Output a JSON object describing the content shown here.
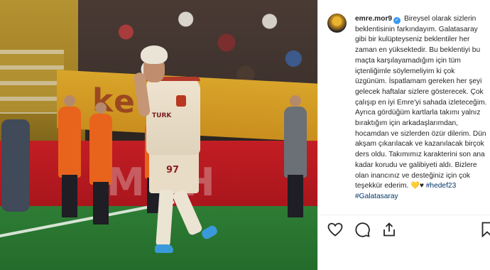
{
  "photo": {
    "banner_text": "keT",
    "wall_text": "MAH",
    "sponsor_text": "TURK",
    "jersey_number": "97"
  },
  "post": {
    "username": "emre.mor9",
    "caption_text": "Bireysel olarak sizlerin beklentisinin farkındayım. Galatasaray gibi bir kulüpteyseniz beklentiler her zaman en yüksektedir. Bu beklentiyi bu maçta karşılayamadığım için tüm içtenliğimle söylemeliyim ki çok üzgünüm. İspatlamam gereken her şeyi gelecek haftalar sizlere gösterecek. Çok çalışıp en iyi Emre'yi sahada izleteceğim. Ayrıca gördüğüm kartlarla takımı yalnız bıraktığım için arkadaşlarımdan, hocamdan ve sizlerden özür dilerim. Dün akşam çıkarılacak ve kazanılacak birçok ders oldu. Takımımız karakterini son ana kadar korudu ve galibiyeti aldı. Bizlere olan inancınız ve desteğiniz için çok teşekkür ederim.",
    "heart_yellow": "💛",
    "heart_black": "♥",
    "hashtag_1": "#hedef23",
    "hashtag_2": "#Galatasaray"
  },
  "colors": {
    "link": "#003569",
    "verified": "#3897f0",
    "text": "#262626"
  },
  "icons": {
    "like": "heart-outline-icon",
    "comment": "comment-bubble-icon",
    "share": "share-upload-icon",
    "save": "bookmark-icon"
  }
}
